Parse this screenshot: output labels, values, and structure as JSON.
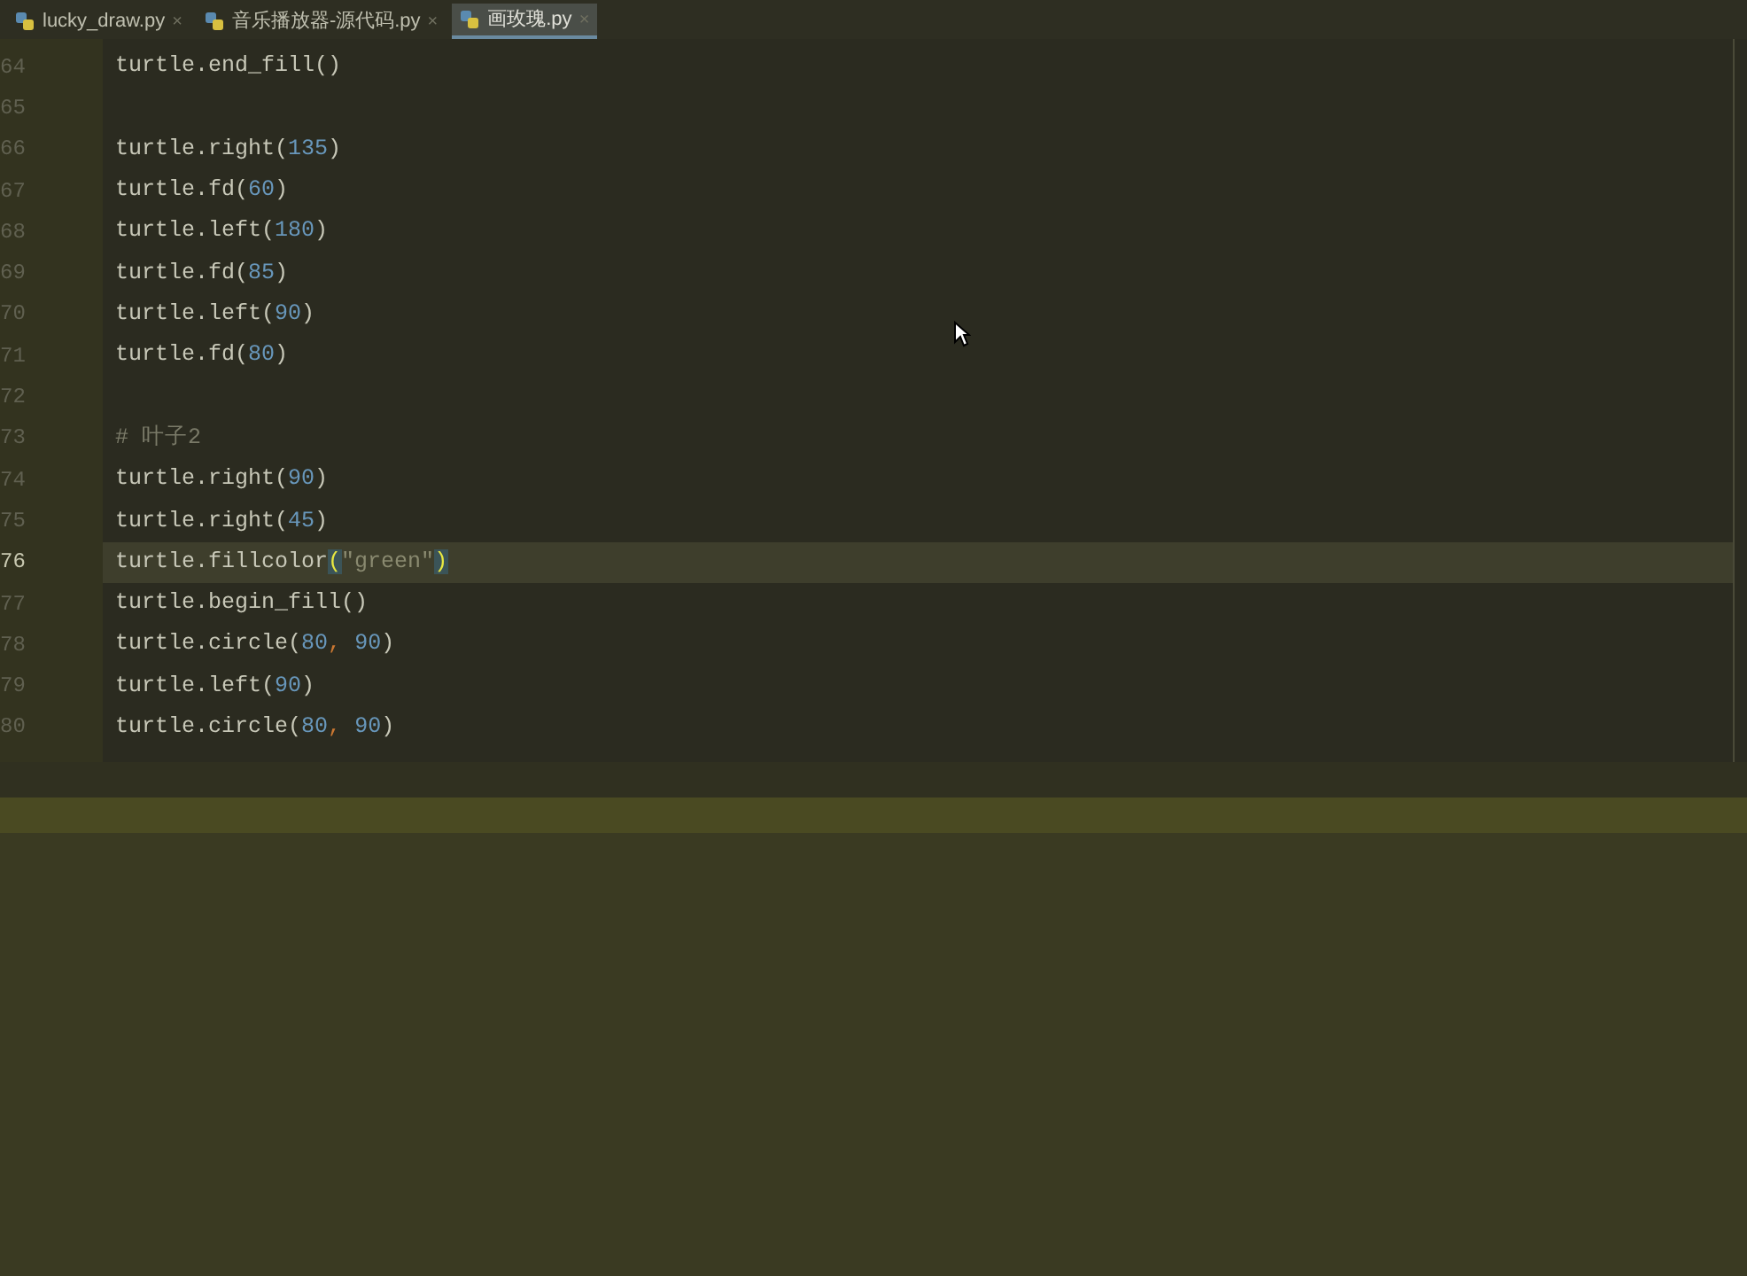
{
  "tabs": [
    {
      "label": "lucky_draw.py",
      "close": "×",
      "selected": false
    },
    {
      "label": "音乐播放器-源代码.py",
      "close": "×",
      "selected": false
    },
    {
      "label": "画玫瑰.py",
      "close": "×",
      "selected": true
    }
  ],
  "editor": {
    "lines": [
      {
        "number": "64",
        "current": false,
        "tokens": [
          {
            "kind": "code",
            "text": "turtle.end_fill()"
          }
        ]
      },
      {
        "number": "65",
        "current": false
      },
      {
        "number": "66",
        "current": false,
        "tokens": [
          {
            "kind": "code",
            "text": "turtle.right("
          },
          {
            "kind": "number",
            "text": "135"
          },
          {
            "kind": "code",
            "text": ")"
          }
        ]
      },
      {
        "number": "67",
        "current": false,
        "tokens": [
          {
            "kind": "code",
            "text": "turtle.fd("
          },
          {
            "kind": "number",
            "text": "60"
          },
          {
            "kind": "code",
            "text": ")"
          }
        ]
      },
      {
        "number": "68",
        "current": false,
        "tokens": [
          {
            "kind": "code",
            "text": "turtle.left("
          },
          {
            "kind": "number",
            "text": "180"
          },
          {
            "kind": "code",
            "text": ")"
          }
        ]
      },
      {
        "number": "69",
        "current": false,
        "tokens": [
          {
            "kind": "code",
            "text": "turtle.fd("
          },
          {
            "kind": "number",
            "text": "85"
          },
          {
            "kind": "code",
            "text": ")"
          }
        ]
      },
      {
        "number": "70",
        "current": false,
        "tokens": [
          {
            "kind": "code",
            "text": "turtle.left("
          },
          {
            "kind": "number",
            "text": "90"
          },
          {
            "kind": "code",
            "text": ")"
          }
        ]
      },
      {
        "number": "71",
        "current": false,
        "tokens": [
          {
            "kind": "code",
            "text": "turtle.fd("
          },
          {
            "kind": "number",
            "text": "80"
          },
          {
            "kind": "code",
            "text": ")"
          }
        ]
      },
      {
        "number": "72",
        "current": false
      },
      {
        "number": "73",
        "current": false,
        "tokens": [
          {
            "kind": "comment",
            "text": "# 叶子2"
          }
        ]
      },
      {
        "number": "74",
        "current": false,
        "tokens": [
          {
            "kind": "code",
            "text": "turtle.right("
          },
          {
            "kind": "number",
            "text": "90"
          },
          {
            "kind": "code",
            "text": ")"
          }
        ]
      },
      {
        "number": "75",
        "current": false,
        "tokens": [
          {
            "kind": "code",
            "text": "turtle.right("
          },
          {
            "kind": "number",
            "text": "45"
          },
          {
            "kind": "code",
            "text": ")"
          }
        ]
      },
      {
        "number": "76",
        "current": true,
        "tokens": [
          {
            "kind": "code",
            "text": "turtle.fillcolor"
          },
          {
            "kind": "brace",
            "text": "("
          },
          {
            "kind": "string",
            "text": "\"green\""
          },
          {
            "kind": "brace",
            "text": ")"
          }
        ]
      },
      {
        "number": "77",
        "current": false,
        "tokens": [
          {
            "kind": "code",
            "text": "turtle.begin_fill()"
          }
        ]
      },
      {
        "number": "78",
        "current": false,
        "tokens": [
          {
            "kind": "code",
            "text": "turtle.circle("
          },
          {
            "kind": "number",
            "text": "80"
          },
          {
            "kind": "comma",
            "text": ","
          },
          {
            "kind": "number",
            "text": " 90"
          },
          {
            "kind": "code",
            "text": ")"
          }
        ]
      },
      {
        "number": "79",
        "current": false,
        "tokens": [
          {
            "kind": "code",
            "text": "turtle.left("
          },
          {
            "kind": "number",
            "text": "90"
          },
          {
            "kind": "code",
            "text": ")"
          }
        ]
      },
      {
        "number": "80",
        "current": false,
        "tokens": [
          {
            "kind": "code",
            "text": "turtle.circle("
          },
          {
            "kind": "number",
            "text": "80"
          },
          {
            "kind": "comma",
            "text": ","
          },
          {
            "kind": "number",
            "text": " 90"
          },
          {
            "kind": "code",
            "text": ")"
          }
        ]
      }
    ]
  }
}
